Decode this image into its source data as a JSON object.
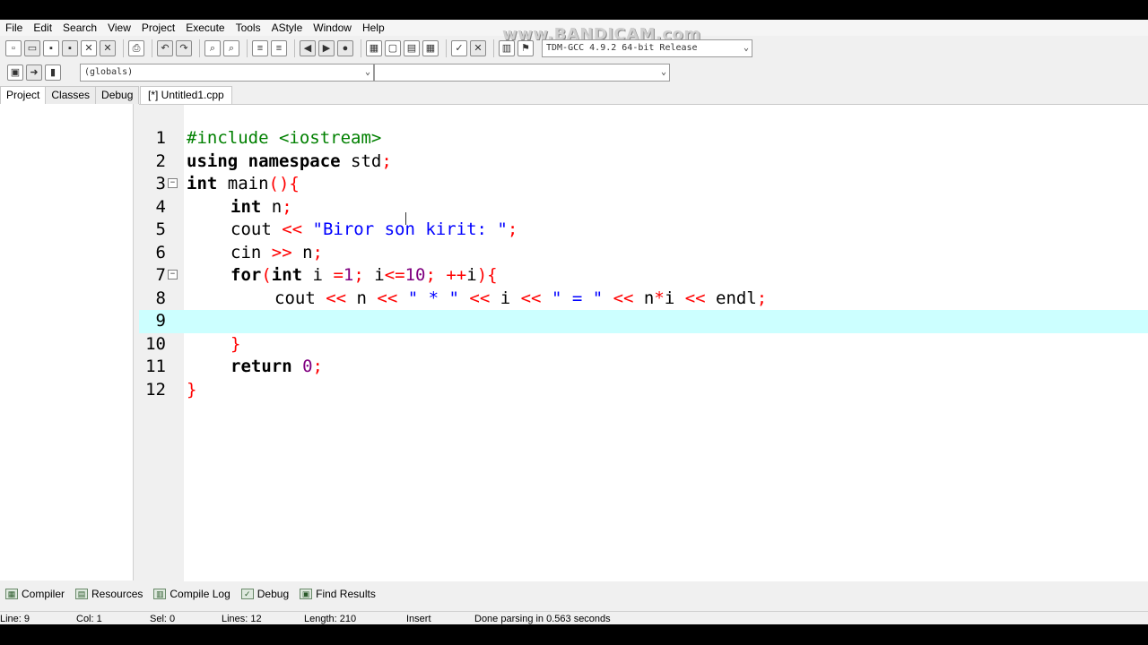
{
  "menu": [
    "File",
    "Edit",
    "Search",
    "View",
    "Project",
    "Execute",
    "Tools",
    "AStyle",
    "Window",
    "Help"
  ],
  "watermark": "www.BANDICAM.com",
  "compiler_select": "TDM-GCC 4.9.2 64-bit Release",
  "scope_select": "(globals)",
  "scope_select2": "",
  "left_tabs": [
    "Project",
    "Classes",
    "Debug"
  ],
  "editor_tab": "[*] Untitled1.cpp",
  "line_numbers": [
    "1",
    "2",
    "3",
    "4",
    "5",
    "6",
    "7",
    "8",
    "9",
    "10",
    "11",
    "12"
  ],
  "code": {
    "l1": "#include <iostream>",
    "l2a": "using namespace ",
    "l2b": "std",
    "l2c": ";",
    "l3a": "int",
    "l3b": " main",
    "l3c": "(){",
    "l4a": "int",
    "l4b": " n",
    "l4c": ";",
    "l5a": "cout ",
    "l5b": "<<",
    "l5c": " \"Biror son kirit: \"",
    "l5d": ";",
    "l6a": "cin ",
    "l6b": ">>",
    "l6c": " n",
    "l6d": ";",
    "l7a": "for",
    "l7b": "(",
    "l7c": "int",
    "l7d": " i ",
    "l7e": "=",
    "l7f": "1",
    "l7g": "; ",
    "l7h": "i",
    "l7i": "<=",
    "l7j": "10",
    "l7k": "; ",
    "l7l": "++",
    "l7m": "i",
    "l7n": "){",
    "l8a": "cout ",
    "l8b": "<<",
    "l8c": " n ",
    "l8d": "<<",
    "l8e": " \" * \" ",
    "l8f": "<<",
    "l8g": " i ",
    "l8h": "<<",
    "l8i": " \" = \" ",
    "l8j": "<<",
    "l8k": " n",
    "l8l": "*",
    "l8m": "i ",
    "l8n": "<<",
    "l8o": " endl",
    "l8p": ";",
    "l10": "}",
    "l11a": "return ",
    "l11b": "0",
    "l11c": ";",
    "l12": "}"
  },
  "bottom_tabs": [
    "Compiler",
    "Resources",
    "Compile Log",
    "Debug",
    "Find Results"
  ],
  "status": {
    "line": "Line:      9",
    "col": "Col:     1",
    "sel": "Sel:     0",
    "lines": "Lines:     12",
    "length": "Length:   210",
    "mode": "Insert",
    "message": "Done parsing in 0.563 seconds"
  },
  "colors": {
    "current_line": "#ccffff",
    "preprocessor": "#008000",
    "symbol": "#ff0000",
    "string": "#0000ff",
    "number": "#800080"
  }
}
